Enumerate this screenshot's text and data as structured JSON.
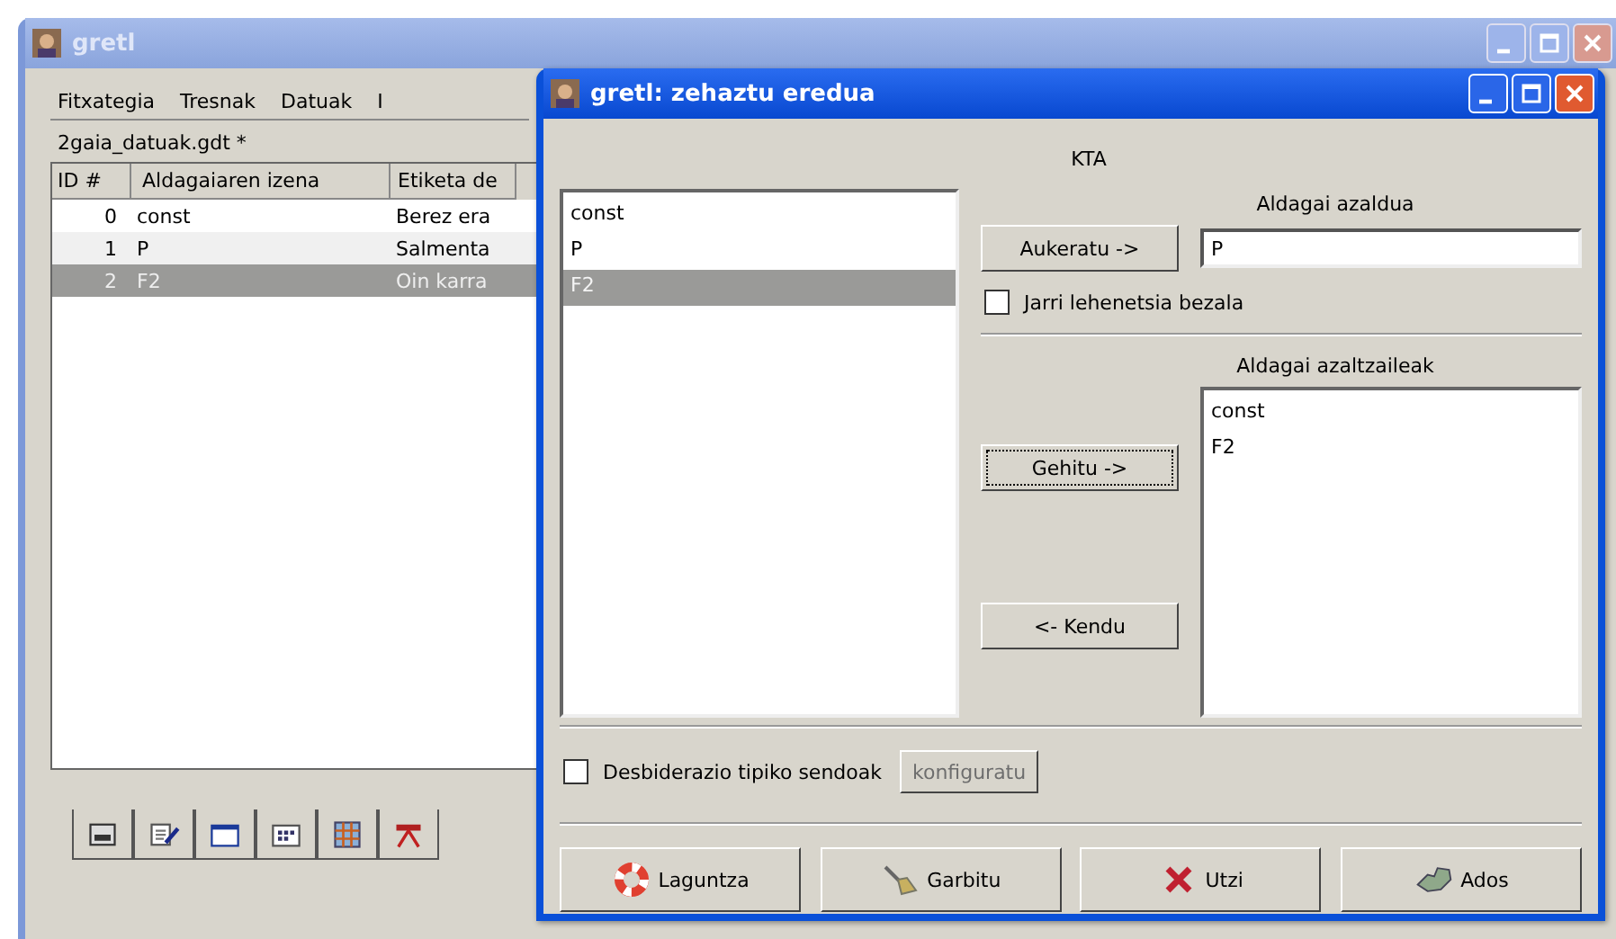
{
  "main_window": {
    "title": "gretl",
    "active": false,
    "menu": [
      {
        "label": "Fitxategia"
      },
      {
        "label": "Tresnak"
      },
      {
        "label": "Datuak"
      },
      {
        "label": "I"
      }
    ],
    "file_name": "2gaia_datuak.gdt *",
    "table": {
      "columns": [
        "ID #",
        "Aldagaiaren izena",
        "Etiketa de"
      ],
      "rows": [
        {
          "cells": [
            "0",
            "const",
            "Berez era"
          ],
          "selected": false
        },
        {
          "cells": [
            "1",
            "P",
            "Salmenta"
          ],
          "selected": false
        },
        {
          "cells": [
            "2",
            "F2",
            "Oin karra"
          ],
          "selected": true
        }
      ]
    }
  },
  "dialog": {
    "title": "gretl: zehaztu eredua",
    "active": true,
    "heading": "KTA",
    "variables": [
      {
        "label": "const",
        "selected": false
      },
      {
        "label": "P",
        "selected": false
      },
      {
        "label": "F2",
        "selected": true
      }
    ],
    "dependent_label": "Aldagai azaldua",
    "choose_button": "Aukeratu ->",
    "dependent_value": "P",
    "default_checkbox": {
      "label": "Jarri lehenetsia bezala",
      "checked": false
    },
    "regressors_label": "Aldagai azaltzaileak",
    "regressors": [
      {
        "label": "const",
        "selected": false
      },
      {
        "label": "F2",
        "selected": false
      }
    ],
    "add_button": "Gehitu ->",
    "remove_button": "<- Kendu",
    "robust_checkbox": {
      "label": "Desbiderazio tipiko sendoak",
      "checked": false
    },
    "configure_button": {
      "label": "konfiguratu",
      "disabled": true
    },
    "buttons": [
      {
        "label": "Laguntza",
        "kind": "help"
      },
      {
        "label": "Garbitu",
        "kind": "clear"
      },
      {
        "label": "Utzi",
        "kind": "cancel"
      },
      {
        "label": "Ados",
        "kind": "ok"
      }
    ]
  }
}
